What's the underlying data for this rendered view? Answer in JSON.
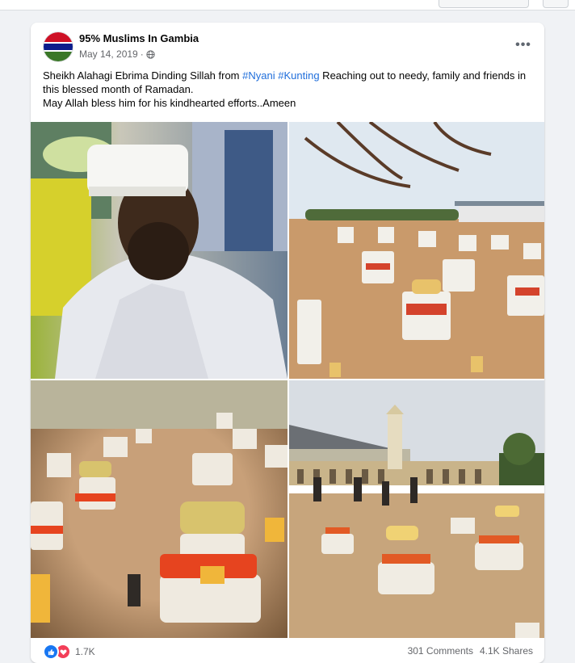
{
  "post": {
    "author": "95% Muslims In Gambia",
    "date": "May 14, 2019",
    "separator": "·",
    "text_before": "Sheikh Alahagi Ebrima Dinding Sillah from ",
    "hashtag1": "#Nyani",
    "hashtag2": "#Kunting",
    "text_after": " Reaching out to needy, family and friends in this blessed month of Ramadan.",
    "text_line2": "May Allah bless him for his kindhearted efforts..Ameen",
    "more_label": "•••",
    "icons": {
      "privacy": "globe-icon",
      "more": "more-options-icon",
      "like": "like-reaction-icon",
      "love": "love-reaction-icon"
    }
  },
  "reactions": {
    "count": "1.7K"
  },
  "stats": {
    "comments": "301 Comments",
    "shares": "4.1K Shares"
  },
  "colors": {
    "hashtag": "#216fdb",
    "like": "#1877f2",
    "love": "#f33e58",
    "flag_red": "#ce1126",
    "flag_blue": "#0c1c8c",
    "flag_green": "#3a7728"
  }
}
